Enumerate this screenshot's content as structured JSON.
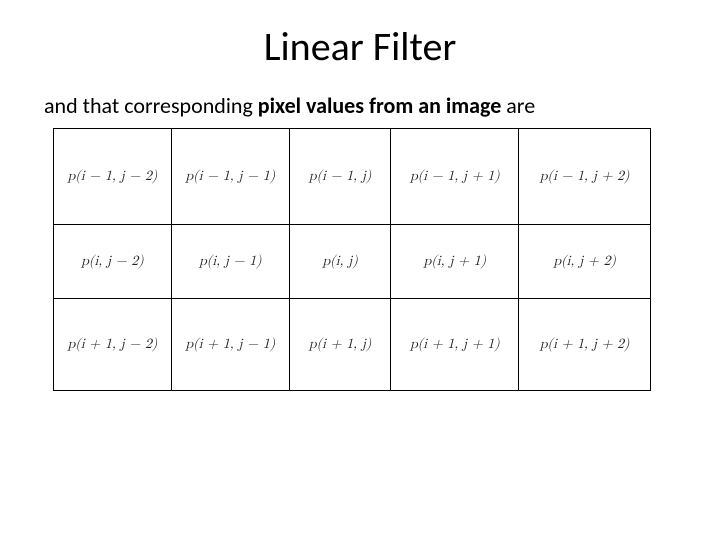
{
  "title": "Linear Filter",
  "intro": {
    "prefix": "and that corresponding ",
    "bold": "pixel values from an image",
    "suffix": " are "
  },
  "grid": {
    "rows": [
      [
        "p(i − 1, j − 2)",
        "p(i − 1, j − 1)",
        "p(i − 1, j)",
        "p(i − 1, j + 1)",
        "p(i − 1, j + 2)"
      ],
      [
        "p(i, j − 2)",
        "p(i, j − 1)",
        "p(i, j)",
        "p(i, j + 1)",
        "p(i, j + 2)"
      ],
      [
        "p(i + 1, j − 2)",
        "p(i + 1, j − 1)",
        "p(i + 1, j)",
        "p(i + 1, j + 1)",
        "p(i + 1, j + 2)"
      ]
    ]
  }
}
